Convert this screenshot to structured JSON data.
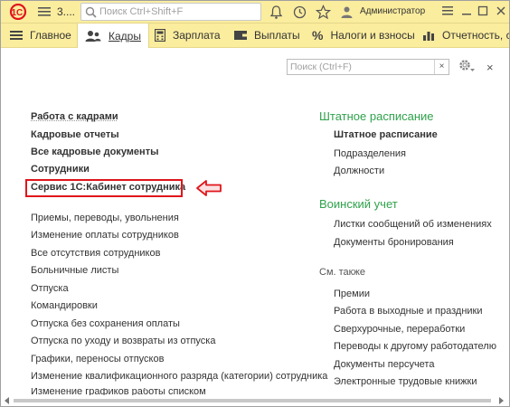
{
  "titlebar": {
    "title": "3....",
    "search_placeholder": "Поиск Ctrl+Shift+F",
    "user": "Администратор"
  },
  "tabs": [
    {
      "label": "Главное",
      "icon": "hamburger-icon"
    },
    {
      "label": "Кадры",
      "icon": "people-icon",
      "active": true
    },
    {
      "label": "Зарплата",
      "icon": "calculator-icon"
    },
    {
      "label": "Выплаты",
      "icon": "wallet-icon"
    },
    {
      "label": "Налоги и взносы",
      "icon": "percent-icon"
    },
    {
      "label": "Отчетность, с",
      "icon": "chart-icon"
    }
  ],
  "panel": {
    "search_placeholder": "Поиск (Ctrl+F)",
    "clear": "×",
    "close": "×"
  },
  "left_bold": [
    "Работа с кадрами",
    "Кадровые отчеты",
    "Все кадровые документы",
    "Сотрудники",
    "Сервис 1С:Кабинет сотрудника"
  ],
  "left_links": [
    "Приемы, переводы, увольнения",
    "Изменение оплаты сотрудников",
    "Все отсутствия сотрудников",
    "Больничные листы",
    "Отпуска",
    "Командировки",
    "Отпуска без сохранения оплаты",
    "Отпуска по уходу и возвраты из отпуска",
    "Графики, переносы отпусков",
    "Изменение квалификационного разряда (категории) сотрудника",
    "Изменение графиков работы списком"
  ],
  "right": {
    "staff_header": "Штатное расписание",
    "staff_bold": "Штатное расписание",
    "staff_links": [
      "Подразделения",
      "Должности"
    ],
    "military_header": "Воинский учет",
    "military_links": [
      "Листки сообщений об изменениях",
      "Документы бронирования"
    ],
    "see_also": "См. также",
    "see_also_links": [
      "Премии",
      "Работа в выходные и праздники",
      "Сверхурочные, переработки",
      "Переводы к другому работодателю",
      "Документы персучета",
      "Электронные трудовые книжки"
    ]
  },
  "colors": {
    "bar": "#fbed9e",
    "accent_green": "#2fa24b",
    "highlight_red": "#e0151c"
  }
}
